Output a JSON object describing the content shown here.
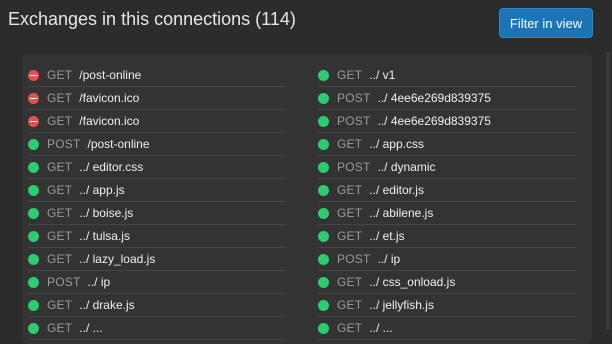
{
  "header": {
    "title": "Exchanges in this connections (114)",
    "filter_button": "Filter in view"
  },
  "colors": {
    "ok": "#2ecc71",
    "error": "#e05252",
    "button": "#1b74b3"
  },
  "left_column": [
    {
      "status": "error",
      "method": "GET",
      "path": "/post-online"
    },
    {
      "status": "error",
      "method": "GET",
      "path": "/favicon.ico"
    },
    {
      "status": "error",
      "method": "GET",
      "path": "/favicon.ico"
    },
    {
      "status": "ok",
      "method": "POST",
      "path": "/post-online"
    },
    {
      "status": "ok",
      "method": "GET",
      "path": "../ editor.css"
    },
    {
      "status": "ok",
      "method": "GET",
      "path": "../ app.js"
    },
    {
      "status": "ok",
      "method": "GET",
      "path": "../ boise.js"
    },
    {
      "status": "ok",
      "method": "GET",
      "path": "../ tulsa.js"
    },
    {
      "status": "ok",
      "method": "GET",
      "path": "../ lazy_load.js"
    },
    {
      "status": "ok",
      "method": "POST",
      "path": "../ ip"
    },
    {
      "status": "ok",
      "method": "GET",
      "path": "../ drake.js"
    },
    {
      "status": "ok",
      "method": "GET",
      "path": "../ ..."
    }
  ],
  "right_column": [
    {
      "status": "ok",
      "method": "GET",
      "path": "../ v1"
    },
    {
      "status": "ok",
      "method": "POST",
      "path": "../ 4ee6e269d839375"
    },
    {
      "status": "ok",
      "method": "POST",
      "path": "../ 4ee6e269d839375"
    },
    {
      "status": "ok",
      "method": "GET",
      "path": "../ app.css"
    },
    {
      "status": "ok",
      "method": "POST",
      "path": "../ dynamic"
    },
    {
      "status": "ok",
      "method": "GET",
      "path": "../ editor.js"
    },
    {
      "status": "ok",
      "method": "GET",
      "path": "../ abilene.js"
    },
    {
      "status": "ok",
      "method": "GET",
      "path": "../ et.js"
    },
    {
      "status": "ok",
      "method": "POST",
      "path": "../ ip"
    },
    {
      "status": "ok",
      "method": "GET",
      "path": "../ css_onload.js"
    },
    {
      "status": "ok",
      "method": "GET",
      "path": "../ jellyfish.js"
    },
    {
      "status": "ok",
      "method": "GET",
      "path": "../ ..."
    }
  ]
}
